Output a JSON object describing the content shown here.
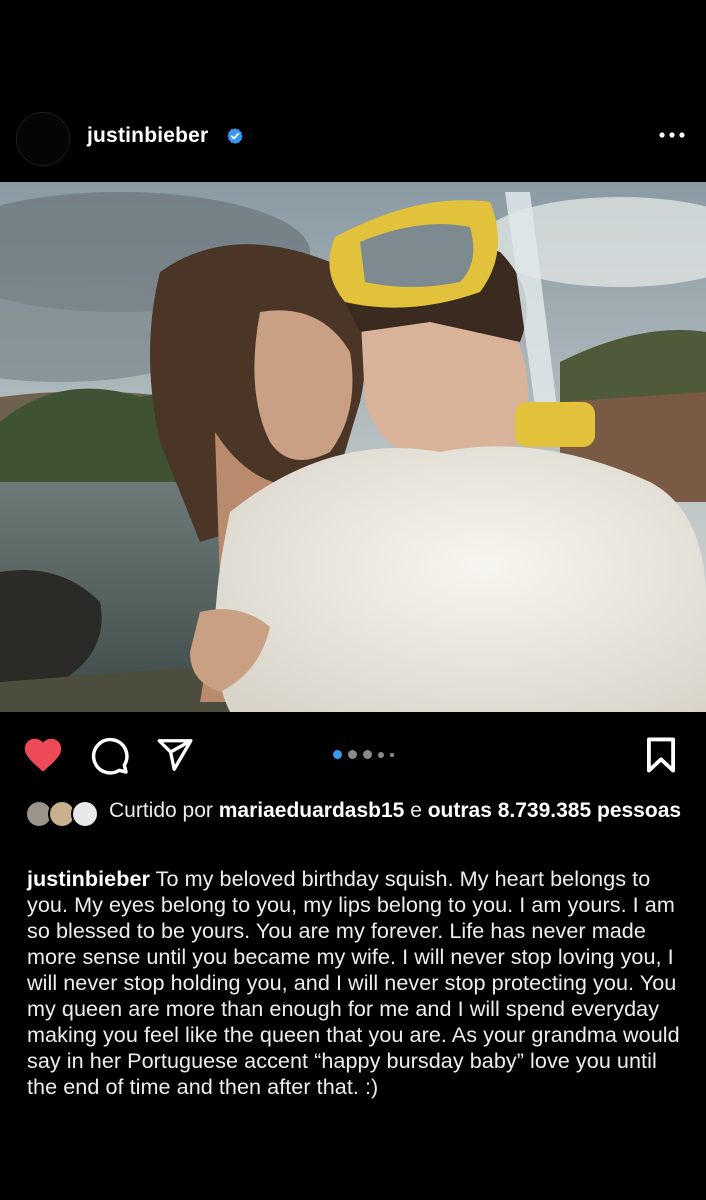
{
  "post": {
    "username": "justinbieber",
    "verified": true,
    "more_icon": "more-horizontal-icon"
  },
  "photo": {
    "media_count": 5,
    "active_index": 0
  },
  "actions": {
    "like_icon": "heart-filled-icon",
    "comment_icon": "comment-icon",
    "share_icon": "send-icon",
    "save_icon": "bookmark-icon",
    "like_color": "#ed4956",
    "active_dot_color": "#3897f0"
  },
  "likes": {
    "prefix": "Curtido por",
    "user": "mariaeduardasb15",
    "connector": "e",
    "others": "outras 8.739.385",
    "suffix": "pessoas"
  },
  "caption": {
    "username": "justinbieber",
    "text": "To my beloved birthday squish. My heart belongs to you. My eyes belong to you, my lips belong to you. I am yours. I am so blessed to be yours. You are my forever. Life has never made more sense until you became my wife. I will never stop loving you, I will never stop holding you, and I will never stop protecting you. You my queen are more than enough for me and I will spend everyday making you feel like the queen that you are. As your grandma would say in her Portuguese accent “happy bursday baby” love you until the end of time and then after that. :)"
  }
}
